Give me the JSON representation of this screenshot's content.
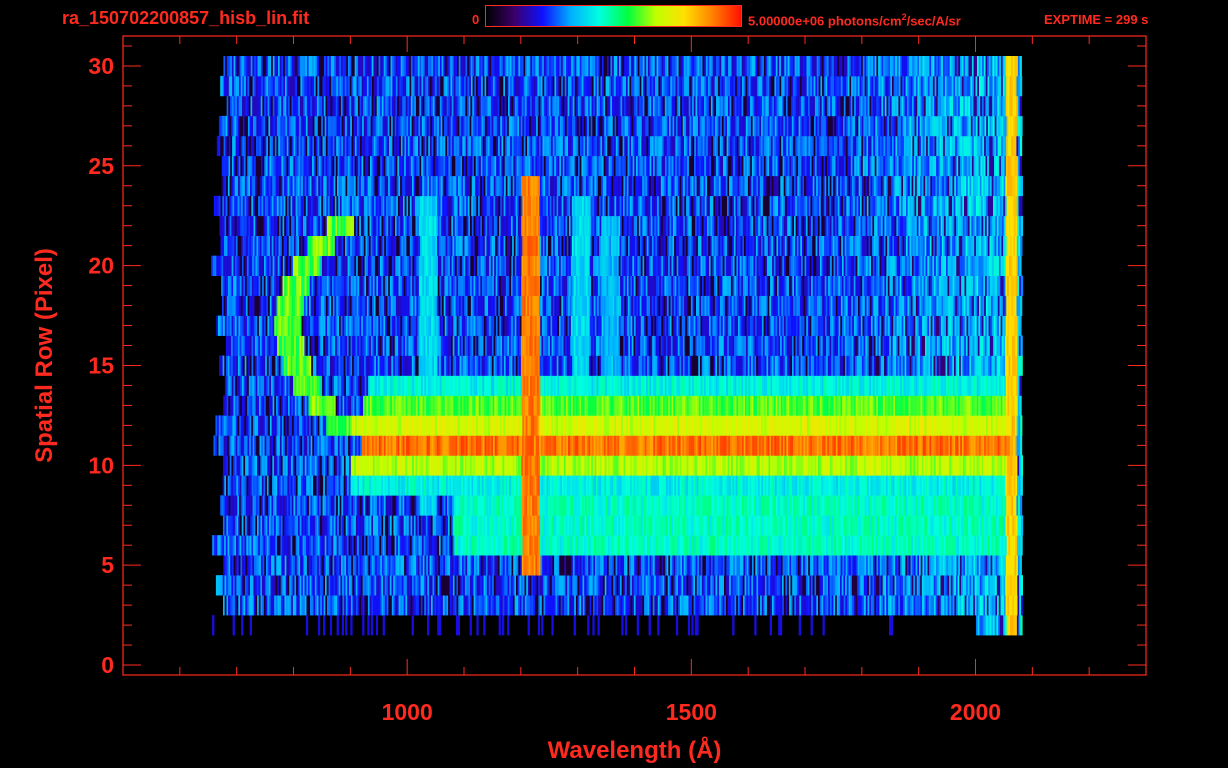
{
  "header": {
    "filename": "ra_150702200857_hisb_lin.fit",
    "colorbar_min": "0",
    "colorbar_max_prefix": "5.00000e+06 photons/cm",
    "colorbar_max_sup": "2",
    "colorbar_max_suffix": "/sec/A/sr",
    "exptime": "EXPTIME = 299 s"
  },
  "colors": {
    "text": "#ff2a1f",
    "background": "#000000",
    "colormap": [
      "#000000",
      "#3a006a",
      "#1010ff",
      "#00b0ff",
      "#00ffe0",
      "#00ff40",
      "#c0ff00",
      "#ffe000",
      "#ff8000",
      "#ff1000"
    ]
  },
  "chart_data": {
    "type": "heatmap",
    "title": "ra_150702200857_hisb_lin.fit",
    "xlabel": "Wavelength (Å)",
    "ylabel": "Spatial Row (Pixel)",
    "xlim": [
      500,
      2300
    ],
    "ylim": [
      -0.5,
      31.5
    ],
    "x_ticks": [
      1000,
      1500,
      2000
    ],
    "y_ticks": [
      0,
      5,
      10,
      15,
      20,
      25,
      30
    ],
    "x_minor_step": 100,
    "y_minor_step": 1,
    "value_range": [
      0,
      5000000
    ],
    "value_unit": "photons/cm2/sec/A/sr",
    "grid": false,
    "data_extent": {
      "x": [
        670,
        2080
      ],
      "rows": [
        2,
        30
      ]
    },
    "features": [
      {
        "type": "horizontal band",
        "rows": [
          11,
          11
        ],
        "x": [
          920,
          2060
        ],
        "level": 0.92
      },
      {
        "type": "horizontal band",
        "rows": [
          12,
          12
        ],
        "x": [
          900,
          2060
        ],
        "level": 0.72
      },
      {
        "type": "horizontal band",
        "rows": [
          10,
          10
        ],
        "x": [
          900,
          2060
        ],
        "level": 0.68
      },
      {
        "type": "horizontal band",
        "rows": [
          13,
          13
        ],
        "x": [
          920,
          2060
        ],
        "level": 0.62
      },
      {
        "type": "horizontal band",
        "rows": [
          14,
          14
        ],
        "x": [
          930,
          2060
        ],
        "level": 0.45
      },
      {
        "type": "horizontal band",
        "rows": [
          9,
          9
        ],
        "x": [
          900,
          2060
        ],
        "level": 0.45
      },
      {
        "type": "horizontal band",
        "rows": [
          6,
          8
        ],
        "x": [
          1080,
          2060
        ],
        "level": 0.48
      },
      {
        "type": "vertical line",
        "x": 1216,
        "rows": [
          5,
          24
        ],
        "level": 0.9
      },
      {
        "type": "vertical line",
        "x": 1304,
        "rows": [
          8,
          23
        ],
        "level": 0.4
      },
      {
        "type": "vertical line",
        "x": 1356,
        "rows": [
          6,
          22
        ],
        "level": 0.36
      },
      {
        "type": "vertical line",
        "x": 1036,
        "rows": [
          8,
          23
        ],
        "level": 0.4
      },
      {
        "type": "edge",
        "x": 2062,
        "rows": [
          2,
          30
        ],
        "level": 0.8
      },
      {
        "type": "arc",
        "x": [
          790,
          880
        ],
        "rows": [
          12,
          22
        ],
        "level": 0.62
      }
    ]
  }
}
